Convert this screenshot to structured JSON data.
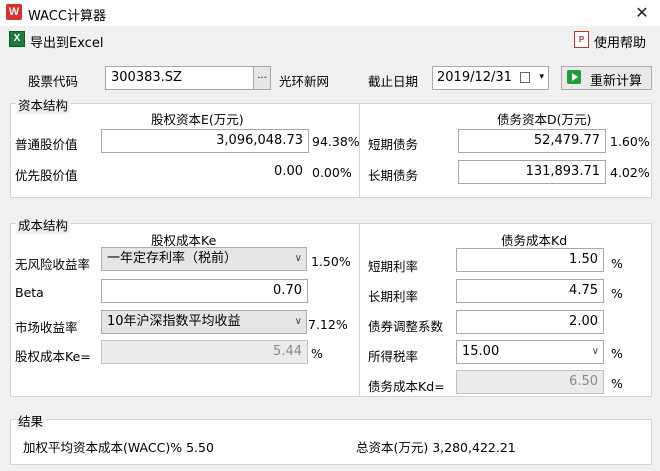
{
  "window": {
    "app_icon_text": "W",
    "title": "WACC计算器",
    "close_glyph": "✕"
  },
  "toolbar": {
    "export_label": "导出到Excel",
    "help_label": "使用帮助"
  },
  "header": {
    "stock_code_label": "股票代码",
    "stock_code_value": "300383.SZ",
    "browse_glyph": "...",
    "company_name": "光环新网",
    "end_date_label": "截止日期",
    "end_date_value": "2019/12/31",
    "recalc_label": "重新计算"
  },
  "capital_structure": {
    "group_title": "资本结构",
    "equity_title": "股权资本E(万元)",
    "debt_title": "债务资本D(万元)",
    "common_label": "普通股价值",
    "common_value": "3,096,048.73",
    "common_pct": "94.38%",
    "preferred_label": "优先股价值",
    "preferred_value": "0.00",
    "preferred_pct": "0.00%",
    "short_debt_label": "短期债务",
    "short_debt_value": "52,479.77",
    "short_debt_pct": "1.60%",
    "long_debt_label": "长期债务",
    "long_debt_value": "131,893.71",
    "long_debt_pct": "4.02%"
  },
  "cost_structure": {
    "group_title": "成本结构",
    "equity_cost_title": "股权成本Ke",
    "debt_cost_title": "债务成本Kd",
    "riskfree_label": "无风险收益率",
    "riskfree_option": "一年定存利率（税前）",
    "riskfree_pct": "1.50%",
    "beta_label": "Beta",
    "beta_value": "0.70",
    "market_label": "市场收益率",
    "market_option": "10年沪深指数平均收益",
    "market_pct": "7.12%",
    "ke_label": "股权成本Ke=",
    "ke_value": "5.44",
    "ke_unit": "%",
    "short_rate_label": "短期利率",
    "short_rate_value": "1.50",
    "short_rate_unit": "%",
    "long_rate_label": "长期利率",
    "long_rate_value": "4.75",
    "long_rate_unit": "%",
    "adj_label": "债券调整系数",
    "adj_value": "2.00",
    "tax_label": "所得税率",
    "tax_value": "15.00",
    "tax_unit": "%",
    "kd_label": "债务成本Kd=",
    "kd_value": "6.50",
    "kd_unit": "%"
  },
  "result": {
    "group_title": "结果",
    "wacc_text": "加权平均资本成本(WACC)% 5.50",
    "total_capital_text": "总资本(万元) 3,280,422.21"
  },
  "colors": {
    "excel_green": "#1f7a3a",
    "play_green": "#1f9d3a",
    "app_red": "#d9302a"
  }
}
